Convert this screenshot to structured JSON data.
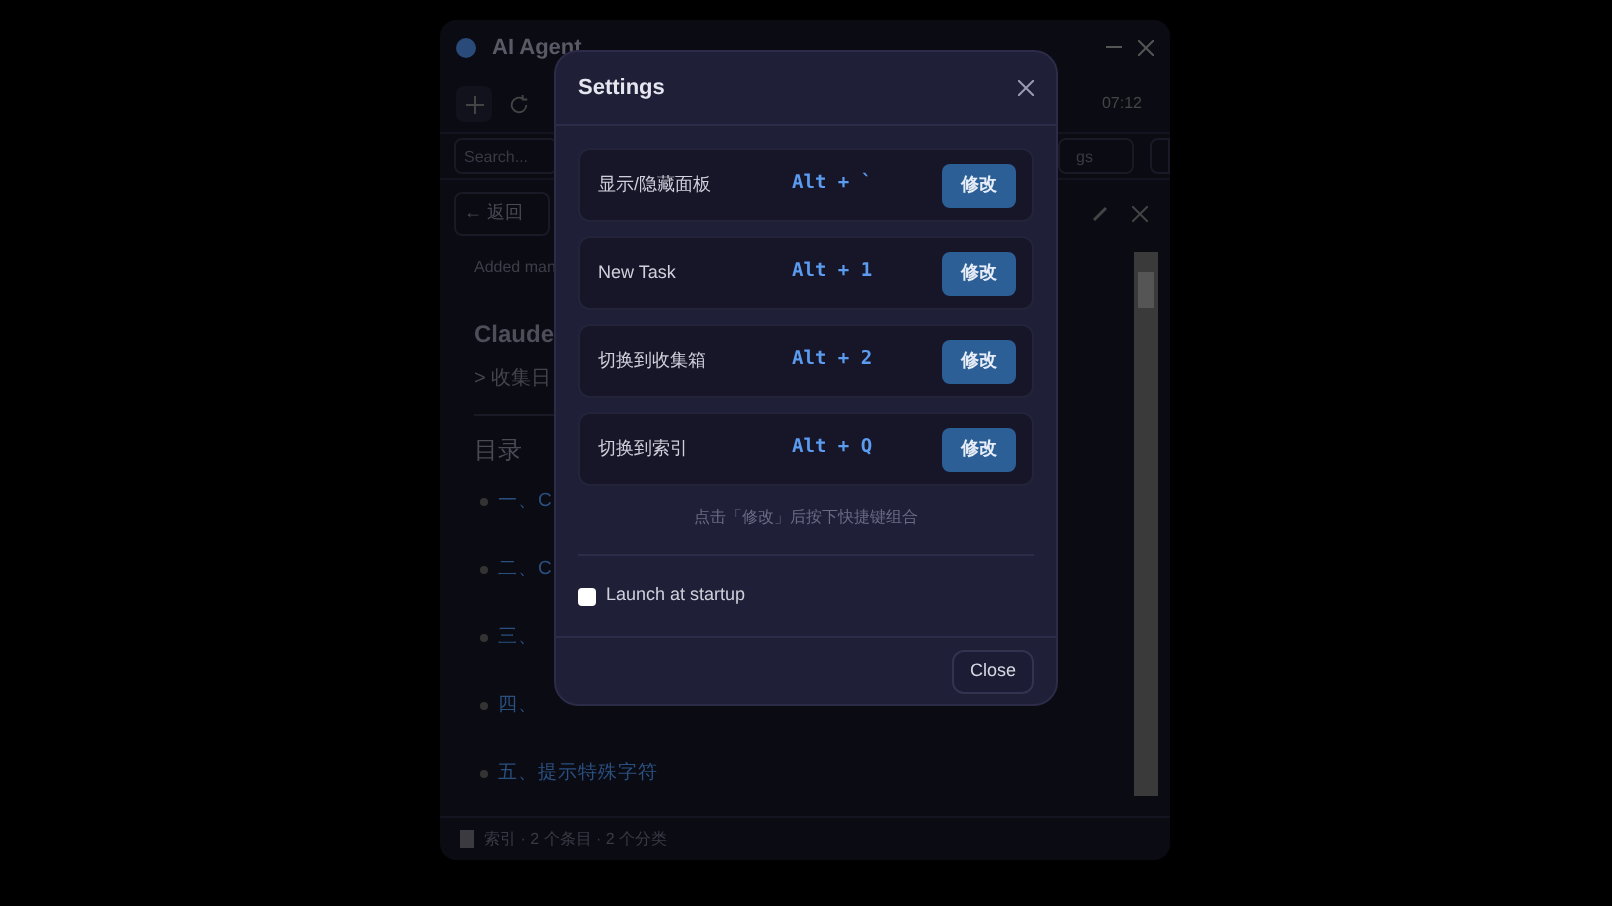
{
  "app": {
    "title": "AI Agent",
    "time": "07:12",
    "search": {
      "placeholder": "Search..."
    },
    "tags_field": {
      "placeholder": "gs"
    },
    "back_button": "← 返回",
    "meta": "Added man",
    "heading": "Claude",
    "quote": "> 收集日",
    "toc_title": "目录",
    "toc": [
      "一、C",
      "二、C",
      "三、",
      "四、",
      "五、提示特殊字符"
    ],
    "status": "索引 · 2 个条目 · 2 个分类"
  },
  "settings": {
    "title": "Settings",
    "shortcuts": [
      {
        "label": "显示/隐藏面板",
        "keys": "Alt + `",
        "button": "修改"
      },
      {
        "label": "New Task",
        "keys": "Alt + 1",
        "button": "修改"
      },
      {
        "label": "切换到收集箱",
        "keys": "Alt + 2",
        "button": "修改"
      },
      {
        "label": "切换到索引",
        "keys": "Alt + Q",
        "button": "修改"
      }
    ],
    "hint": "点击「修改」后按下快捷键组合",
    "launch": {
      "label": "Launch at startup",
      "checked": false
    },
    "close_button": "Close"
  }
}
